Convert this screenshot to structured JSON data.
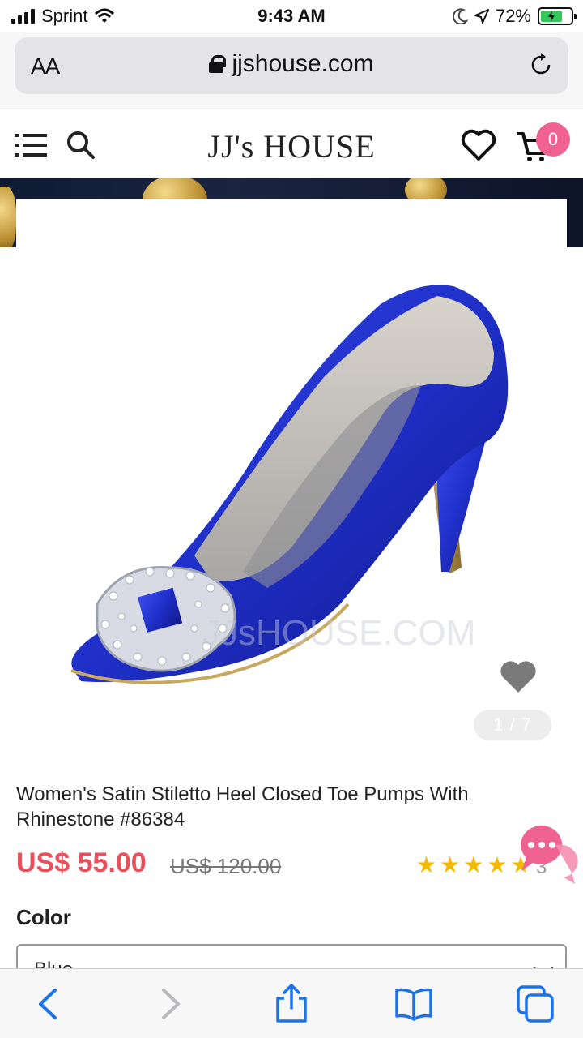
{
  "status_bar": {
    "carrier": "Sprint",
    "time": "9:43 AM",
    "battery": "72%",
    "battery_level": 0.72
  },
  "browser": {
    "text_size_label": "AA",
    "url": "jjshouse.com"
  },
  "site": {
    "logo": "JJ's HOUSE",
    "cart_count": "0"
  },
  "product": {
    "image_counter": "1 / 7",
    "title": "Women's Satin Stiletto Heel Closed Toe Pumps With Rhinestone #86384",
    "price": "US$ 55.00",
    "old_price": "US$ 120.00",
    "rating_stars": 5,
    "review_count": "3",
    "color_label": "Color",
    "color_value": "Blue"
  },
  "colors": {
    "accent": "#e8505b",
    "badge": "#f06292",
    "star": "#f5b800",
    "ios_blue": "#1a73e8",
    "shoe_blue": "#1f2fc8"
  },
  "icons": [
    "menu-icon",
    "search-icon",
    "heart-icon",
    "cart-icon",
    "reload-icon",
    "lock-icon",
    "chat-icon",
    "back-icon",
    "forward-icon",
    "share-icon",
    "bookmarks-icon",
    "tabs-icon"
  ]
}
